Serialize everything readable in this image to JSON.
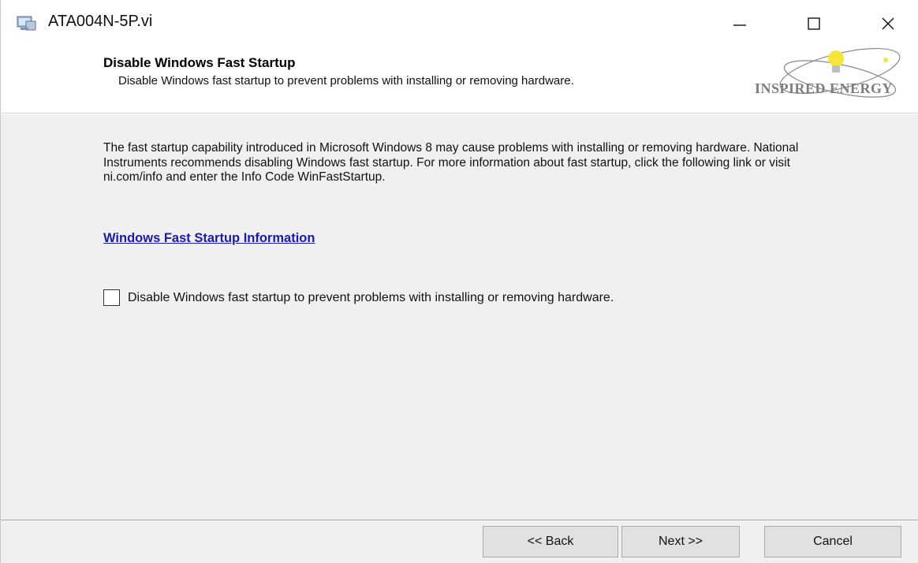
{
  "window": {
    "title": "ATA004N-5P.vi",
    "icon": "installer-icon",
    "controls": {
      "minimize": "minimize-icon",
      "maximize": "maximize-icon",
      "close": "close-icon"
    }
  },
  "header": {
    "title": "Disable Windows Fast Startup",
    "subtitle": "Disable Windows fast startup to prevent problems with installing or removing hardware.",
    "logo_text": "INSPIRED ENERGY"
  },
  "main": {
    "description": "The fast startup capability introduced in Microsoft Windows 8 may cause problems with installing or removing hardware. National Instruments recommends disabling Windows fast startup. For more information about fast startup, click the following link or visit ni.com/info and enter the Info Code WinFastStartup.",
    "link_text": "Windows Fast Startup Information",
    "checkbox": {
      "label": "Disable Windows fast startup to prevent problems with installing or removing hardware.",
      "checked": false
    }
  },
  "footer": {
    "back_label": "<< Back",
    "next_label": "Next >>",
    "cancel_label": "Cancel"
  },
  "colors": {
    "link": "#1a1ab0",
    "panel_background": "#f0f0f0",
    "header_background": "#ffffff",
    "logo_bulb": "#f7e63a"
  }
}
